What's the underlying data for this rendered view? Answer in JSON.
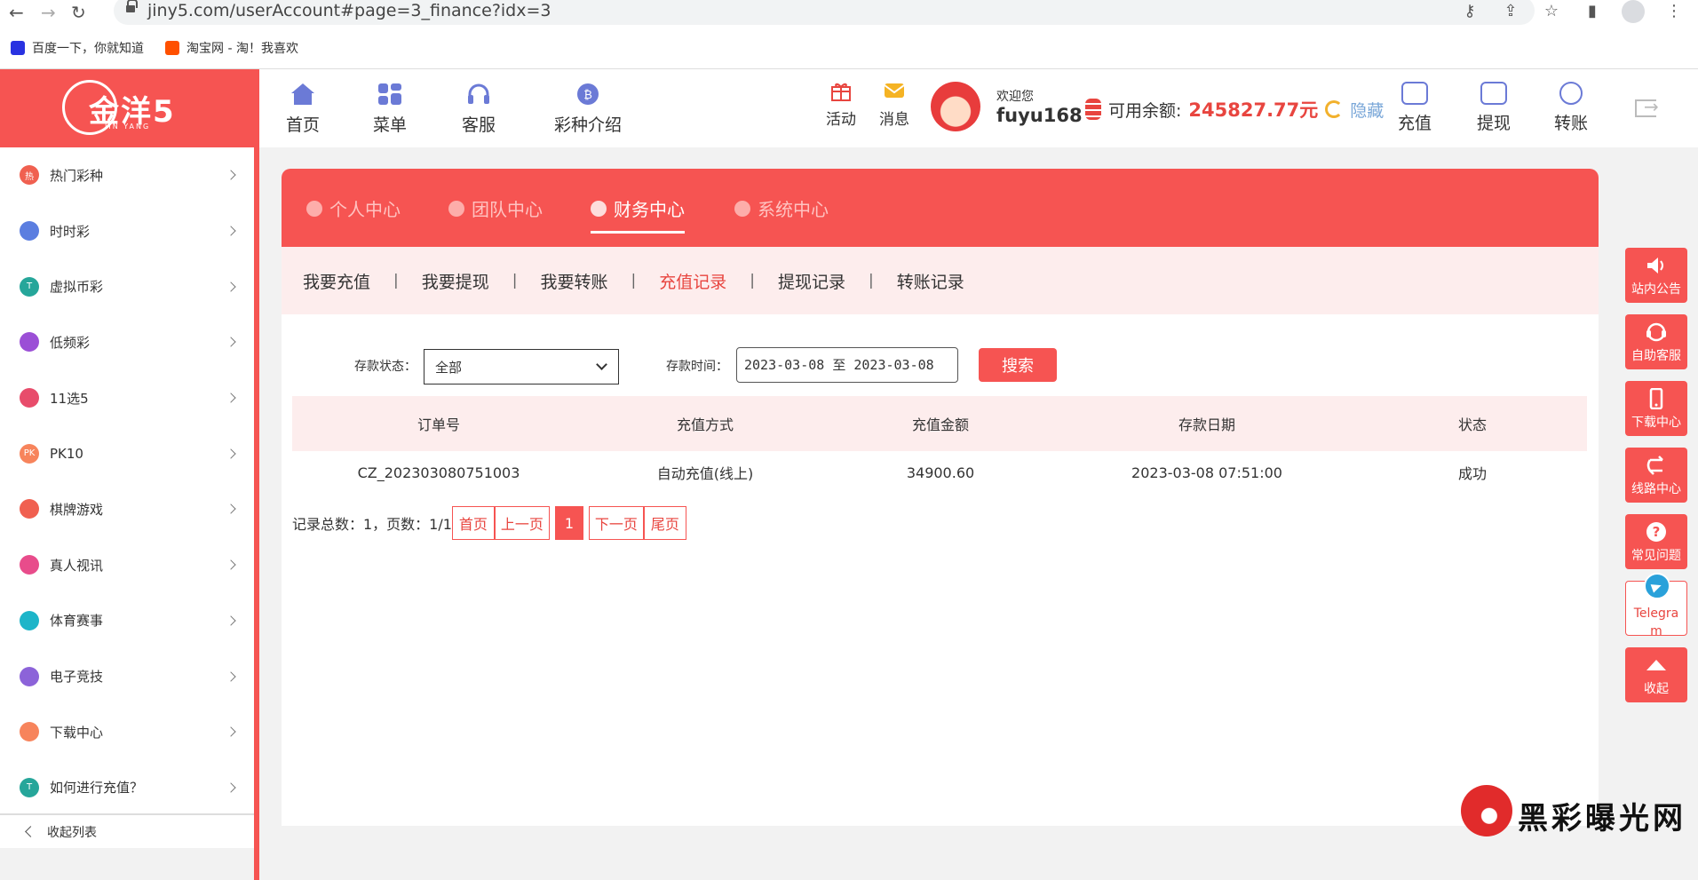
{
  "browser": {
    "url": "jiny5.com/userAccount#page=3_finance?idx=3",
    "bookmarks": [
      {
        "label": "百度一下，你就知道",
        "color": "#2932e1"
      },
      {
        "label": "淘宝网 - 淘！我喜欢",
        "color": "#ff5000"
      }
    ]
  },
  "colors": {
    "brand": "#f65452",
    "accent_text": "#e8453f",
    "subnav_bg": "#fdeded"
  },
  "logo": {
    "text": "金洋5",
    "sub": "JIN YANG"
  },
  "sidebar": {
    "items": [
      {
        "label": "热门彩种",
        "icon": "hot-icon",
        "color": "#f06050",
        "badge": "热"
      },
      {
        "label": "时时彩",
        "icon": "ssc-icon",
        "color": "#5b7ee0",
        "badge": ""
      },
      {
        "label": "虚拟币彩",
        "icon": "tether-icon",
        "color": "#26a69a",
        "badge": "T"
      },
      {
        "label": "低频彩",
        "icon": "lowfreq-icon",
        "color": "#9b4fd6",
        "badge": ""
      },
      {
        "label": "11选5",
        "icon": "eleven-five-icon",
        "color": "#e84c6b",
        "badge": ""
      },
      {
        "label": "PK10",
        "icon": "pk10-icon",
        "color": "#f7845c",
        "badge": "PK"
      },
      {
        "label": "棋牌游戏",
        "icon": "cards-icon",
        "color": "#f06050",
        "badge": ""
      },
      {
        "label": "真人视讯",
        "icon": "live-dealer-icon",
        "color": "#e84c8b",
        "badge": ""
      },
      {
        "label": "体育赛事",
        "icon": "soccer-icon",
        "color": "#1db5c9",
        "badge": ""
      },
      {
        "label": "电子竞技",
        "icon": "esports-icon",
        "color": "#8c63d9",
        "badge": ""
      },
      {
        "label": "下载中心",
        "icon": "phone-icon",
        "color": "#f7845c",
        "badge": ""
      },
      {
        "label": "如何进行充值？",
        "icon": "tether-icon",
        "color": "#26a69a",
        "badge": "T"
      }
    ],
    "collapse_label": "收起列表"
  },
  "topnav": {
    "items": [
      {
        "label": "首页",
        "icon": "home-icon"
      },
      {
        "label": "菜单",
        "icon": "menu-grid-icon"
      },
      {
        "label": "客服",
        "icon": "headset-icon"
      },
      {
        "label": "彩种介绍",
        "icon": "lottery-intro-icon"
      }
    ],
    "activity_label": "活动",
    "message_label": "消息",
    "welcome": "欢迎您",
    "username": "fuyu168",
    "balance_label": "可用余额:",
    "balance_value": "245827.77元",
    "hide_label": "隐藏",
    "recharge_label": "充值",
    "withdraw_label": "提现",
    "transfer_label": "转账"
  },
  "card": {
    "tabs": [
      {
        "label": "个人中心",
        "active": false
      },
      {
        "label": "团队中心",
        "active": false
      },
      {
        "label": "财务中心",
        "active": true
      },
      {
        "label": "系统中心",
        "active": false
      }
    ],
    "subnav": [
      {
        "label": "我要充值",
        "active": false
      },
      {
        "label": "我要提现",
        "active": false
      },
      {
        "label": "我要转账",
        "active": false
      },
      {
        "label": "充值记录",
        "active": true
      },
      {
        "label": "提现记录",
        "active": false
      },
      {
        "label": "转账记录",
        "active": false
      }
    ],
    "filters": {
      "status_label": "存款状态：",
      "status_value": "全部",
      "time_label": "存款时间：",
      "time_value": "2023-03-08 至 2023-03-08",
      "search_label": "搜索"
    },
    "table": {
      "headers": [
        "订单号",
        "充值方式",
        "充值金额",
        "存款日期",
        "状态"
      ],
      "rows": [
        [
          "CZ_202303080751003",
          "自动充值(线上)",
          "34900.60",
          "2023-03-08 07:51:00",
          "成功"
        ]
      ]
    },
    "pager": {
      "summary": "记录总数：1，页数：1/1",
      "first": "首页",
      "prev": "上一页",
      "current": "1",
      "next": "下一页",
      "last": "尾页"
    }
  },
  "right_bar": {
    "items": [
      {
        "label": "站内公告",
        "icon": "speaker-icon"
      },
      {
        "label": "自助客服",
        "icon": "support-headset-icon"
      },
      {
        "label": "下载中心",
        "icon": "mobile-icon"
      },
      {
        "label": "线路中心",
        "icon": "route-icon"
      },
      {
        "label": "常见问题",
        "icon": "question-icon"
      }
    ],
    "telegram_label": "Telegra m",
    "collapse_label": "收起"
  },
  "watermark": {
    "text": "黑彩曝光网"
  }
}
